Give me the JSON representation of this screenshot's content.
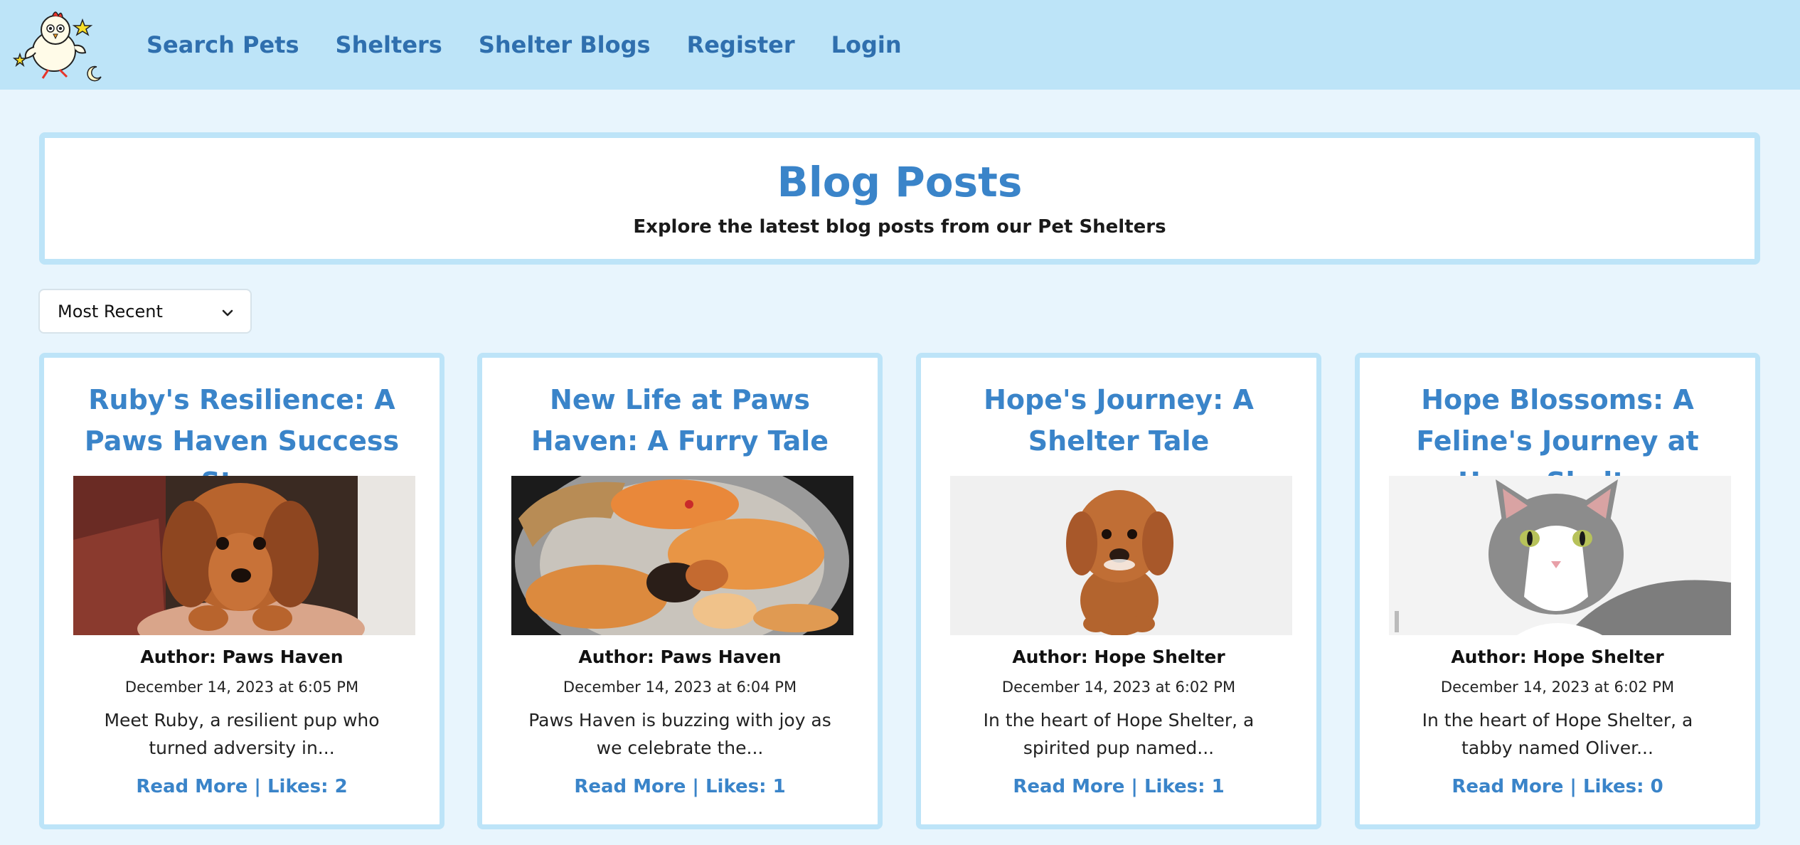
{
  "nav": {
    "links": [
      "Search Pets",
      "Shelters",
      "Shelter Blogs",
      "Register",
      "Login"
    ]
  },
  "header": {
    "title": "Blog Posts",
    "subtitle": "Explore the latest blog posts from our Pet Shelters"
  },
  "sort": {
    "selected": "Most Recent"
  },
  "posts": [
    {
      "title": "Ruby's Resilience: A Paws Haven Success Story",
      "author": "Author: Paws Haven",
      "date": "December 14, 2023 at 6:05 PM",
      "excerpt": "Meet Ruby, a resilient pup who turned adversity in...",
      "link": "Read More | Likes: 2",
      "image": "dachshund-puppy-photo"
    },
    {
      "title": "New Life at Paws Haven: A Furry Tale",
      "author": "Author: Paws Haven",
      "date": "December 14, 2023 at 6:04 PM",
      "excerpt": "Paws Haven is buzzing with joy as we celebrate the...",
      "link": "Read More | Likes: 1",
      "image": "cat-with-kittens-photo"
    },
    {
      "title": "Hope's Journey: A Shelter Tale",
      "author": "Author: Hope Shelter",
      "date": "December 14, 2023 at 6:02 PM",
      "excerpt": "In the heart of Hope Shelter, a spirited pup named...",
      "link": "Read More | Likes: 1",
      "image": "poodle-puppy-in-snow-photo"
    },
    {
      "title": "Hope Blossoms: A Feline's Journey at Hope Shelter",
      "author": "Author: Hope Shelter",
      "date": "December 14, 2023 at 6:02 PM",
      "excerpt": "In the heart of Hope Shelter, a tabby named Oliver...",
      "link": "Read More | Likes: 0",
      "image": "grey-white-cat-photo"
    }
  ],
  "colors": {
    "nav_bg": "#bde4f8",
    "page_bg": "#e8f5fd",
    "accent": "#3a84c9",
    "nav_link": "#2f6fae"
  }
}
